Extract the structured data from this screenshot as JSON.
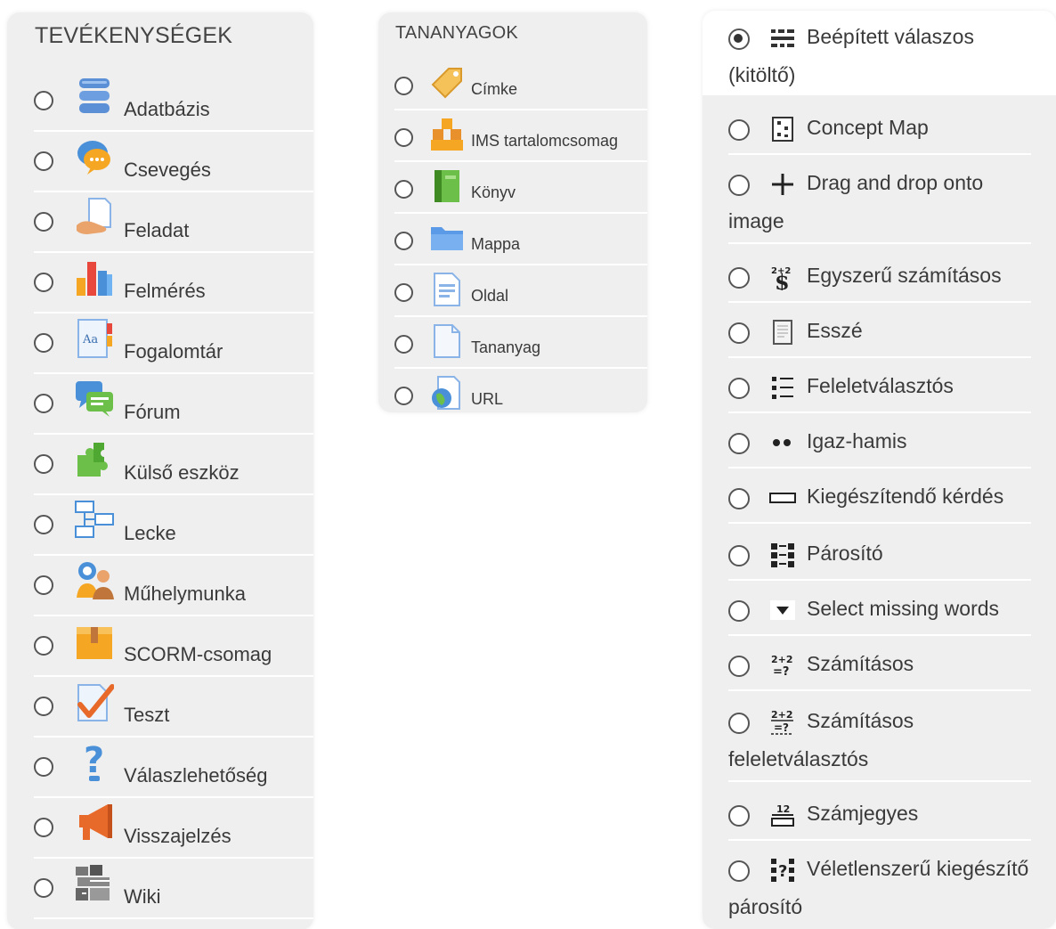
{
  "activities": {
    "title": "TEVÉKENYSÉGEK",
    "items": [
      {
        "label": "Adatbázis",
        "icon": "database-icon"
      },
      {
        "label": "Csevegés",
        "icon": "chat-icon"
      },
      {
        "label": "Feladat",
        "icon": "assignment-icon"
      },
      {
        "label": "Felmérés",
        "icon": "survey-chart-icon"
      },
      {
        "label": "Fogalomtár",
        "icon": "glossary-icon"
      },
      {
        "label": "Fórum",
        "icon": "forum-icon"
      },
      {
        "label": "Külső eszköz",
        "icon": "puzzle-icon"
      },
      {
        "label": "Lecke",
        "icon": "lesson-icon"
      },
      {
        "label": "Műhelymunka",
        "icon": "workshop-icon"
      },
      {
        "label": "SCORM-csomag",
        "icon": "package-icon"
      },
      {
        "label": "Teszt",
        "icon": "quiz-check-icon"
      },
      {
        "label": "Válaszlehetőség",
        "icon": "question-mark-icon"
      },
      {
        "label": "Visszajelzés",
        "icon": "megaphone-icon"
      },
      {
        "label": "Wiki",
        "icon": "wiki-icon"
      }
    ]
  },
  "resources": {
    "title": "TANANYAGOK",
    "items": [
      {
        "label": "Címke",
        "icon": "tag-icon"
      },
      {
        "label": "IMS tartalomcsomag",
        "icon": "ims-boxes-icon"
      },
      {
        "label": "Könyv",
        "icon": "book-icon"
      },
      {
        "label": "Mappa",
        "icon": "folder-icon"
      },
      {
        "label": "Oldal",
        "icon": "page-icon"
      },
      {
        "label": "Tananyag",
        "icon": "file-icon"
      },
      {
        "label": "URL",
        "icon": "globe-url-icon"
      }
    ]
  },
  "questions": {
    "selected_index": 0,
    "items": [
      {
        "label": "Beépített válaszos",
        "label2": "(kitöltő)",
        "icon": "embedded-answers-icon"
      },
      {
        "label": "Concept Map",
        "label2": "",
        "icon": "concept-map-icon"
      },
      {
        "label": "Drag and drop onto",
        "label2": "image",
        "icon": "drag-move-icon"
      },
      {
        "label": "Egyszerű számításos",
        "label2": "",
        "icon": "simple-calculated-icon"
      },
      {
        "label": "Esszé",
        "label2": "",
        "icon": "essay-icon"
      },
      {
        "label": "Feleletválasztós",
        "label2": "",
        "icon": "multichoice-icon"
      },
      {
        "label": "Igaz-hamis",
        "label2": "",
        "icon": "true-false-icon"
      },
      {
        "label": "Kiegészítendő kérdés",
        "label2": "",
        "icon": "short-answer-icon"
      },
      {
        "label": "Párosító",
        "label2": "",
        "icon": "matching-icon"
      },
      {
        "label": "Select missing words",
        "label2": "",
        "icon": "dropdown-triangle-icon"
      },
      {
        "label": "Számításos",
        "label2": "",
        "icon": "calculated-icon"
      },
      {
        "label": "Számításos",
        "label2": "feleletválasztós",
        "icon": "calculated-multi-icon"
      },
      {
        "label": "Számjegyes",
        "label2": "",
        "icon": "numerical-icon"
      },
      {
        "label": "Véletlenszerű kiegészítő",
        "label2": "párosító",
        "icon": "random-match-icon"
      }
    ]
  }
}
